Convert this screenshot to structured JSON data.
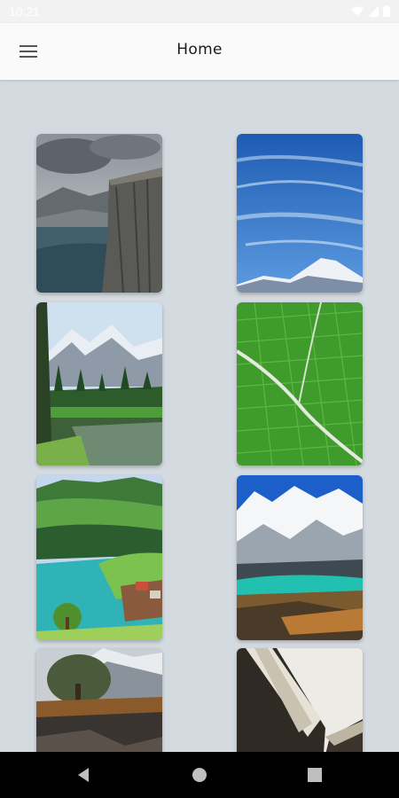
{
  "status_bar": {
    "time": "10:21",
    "icons": [
      "wifi-icon",
      "signal-icon",
      "battery-icon"
    ]
  },
  "app_bar": {
    "title": "Home",
    "menu_icon": "hamburger-menu-icon"
  },
  "wallpapers": [
    {
      "scene": "cliff-fjord"
    },
    {
      "scene": "blue-sky-mountain"
    },
    {
      "scene": "alpine-lake-forest"
    },
    {
      "scene": "green-rice-fields"
    },
    {
      "scene": "valley-turquoise-lake"
    },
    {
      "scene": "snowy-mountains-lake"
    },
    {
      "scene": "rocky-shore-tree"
    },
    {
      "scene": "white-rock-cliffs"
    }
  ],
  "nav_bar": {
    "icons": [
      "back-icon",
      "home-icon",
      "recents-icon"
    ]
  },
  "colors": {
    "background": "#d4dbe0",
    "app_bar": "#fafafa",
    "nav_bar": "#000000"
  }
}
